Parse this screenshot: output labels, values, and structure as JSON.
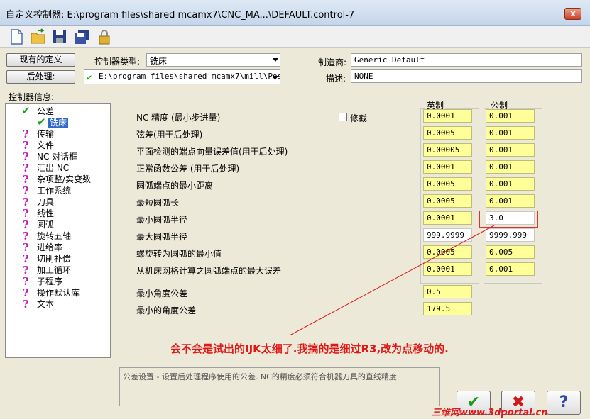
{
  "window": {
    "title": "自定义控制器: E:\\program files\\shared mcamx7\\CNC_MA...\\DEFAULT.control-7",
    "close": "x"
  },
  "toolbar": {
    "icons": [
      "new-file-icon",
      "open-folder-icon",
      "save-icon",
      "save-all-icon",
      "lock-icon"
    ]
  },
  "header": {
    "current_def_button": "现有的定义",
    "post_button": "后处理:",
    "controller_type_label": "控制器类型:",
    "controller_type_value": "铣床",
    "post_path": "E:\\program files\\shared mcamx7\\mill\\Pos·",
    "manufacturer_label": "制造商:",
    "manufacturer_value": "Generic Default",
    "description_label": "描述:",
    "description_value": "NONE",
    "controller_info_label": "控制器信息:"
  },
  "tree": {
    "root": "公差",
    "selected": "铣床",
    "items": [
      "传输",
      "文件",
      "NC 对话框",
      "汇出 NC",
      "杂项整/实变数",
      "工作系统",
      "刀具",
      "线性",
      "圆弧",
      "旋转五轴",
      "进给率",
      "切削补偿",
      "加工循环",
      "子程序",
      "操作默认库",
      "文本"
    ]
  },
  "tolerance": {
    "col_english": "英制",
    "col_metric": "公制",
    "modify_label": "修截",
    "rows": [
      {
        "label": "NC 精度 (最小步进量)",
        "english": "0.0001",
        "metric": "0.001"
      },
      {
        "label": "弦差(用于后处理)",
        "english": "0.0005",
        "metric": "0.001"
      },
      {
        "label": "平面检测的端点向量误差值(用于后处理)",
        "english": "0.00005",
        "metric": "0.001"
      },
      {
        "label": "正常函数公差  (用于后处理)",
        "english": "0.0001",
        "metric": "0.001"
      },
      {
        "label": "圆弧端点的最小距离",
        "english": "0.0005",
        "metric": "0.001"
      },
      {
        "label": "最短圆弧长",
        "english": "0.0005",
        "metric": "0.001"
      },
      {
        "label": "最小圆弧半径",
        "english": "0.0001",
        "metric": "3.0"
      },
      {
        "label": "最大圆弧半径",
        "english": "999.9999",
        "metric": "9999.999"
      },
      {
        "label": "螺旋转为圆弧的最小值",
        "english": "0.0005",
        "metric": "0.005"
      },
      {
        "label": "从机床网格计算之圆弧端点的最大误差",
        "english": "0.0001",
        "metric": "0.001"
      }
    ],
    "angle_rows": [
      {
        "label": "最小角度公差",
        "value": "0.5"
      },
      {
        "label": "最小的角度公差",
        "value": "179.5"
      }
    ]
  },
  "annotation": "会不会是试出的IJK太细了.我搞的是细过R3,改为点移动的.",
  "status_description": "公差设置 - 设置后处理程序使用的公差. NC的精度必须符合机器刀具的直线精度",
  "buttons": {
    "ok": "✔",
    "cancel": "✖",
    "help": "?"
  },
  "watermark": "三维网www.3dportal.cn",
  "colors": {
    "value_bg": "#ffff99",
    "annotation": "#e01818",
    "highlight_box": "#e03030"
  }
}
